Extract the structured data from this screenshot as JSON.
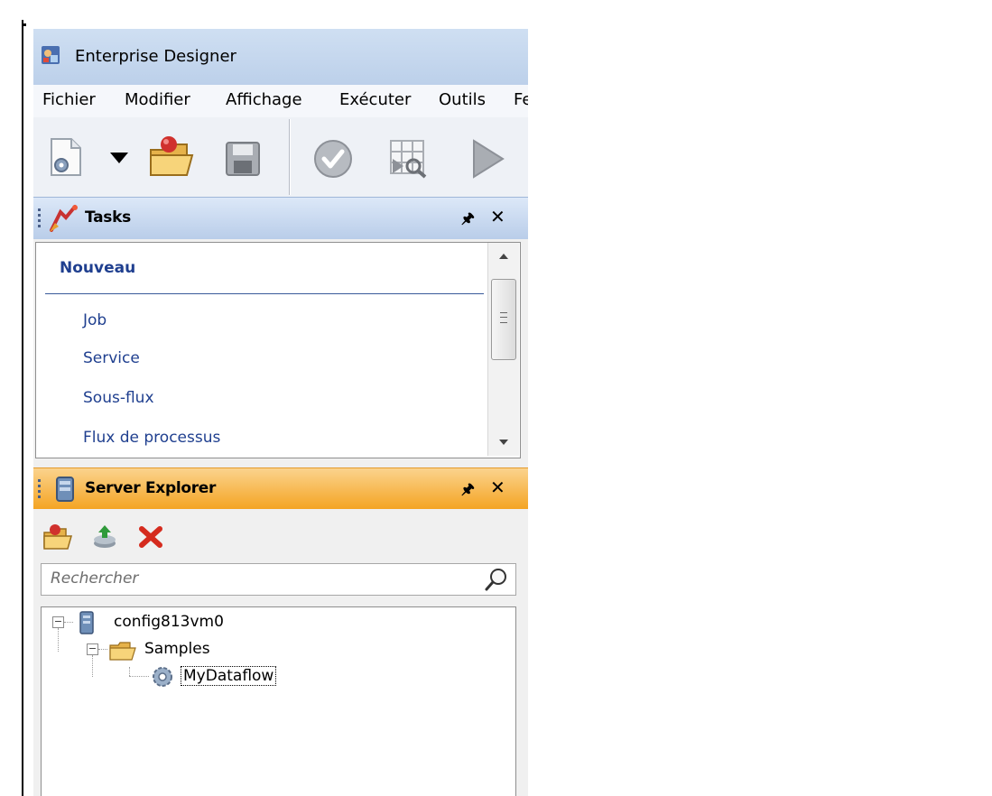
{
  "window": {
    "title": "Enterprise Designer"
  },
  "menu": {
    "items": [
      "Fichier",
      "Modifier",
      "Affichage",
      "Exécuter",
      "Outils",
      "Fe"
    ]
  },
  "toolbar": {
    "buttons": [
      "new-icon",
      "dropdown-arrow-icon",
      "open-folder-icon",
      "save-icon",
      "validate-icon",
      "inspect-icon",
      "run-icon"
    ]
  },
  "tasks": {
    "title": "Tasks",
    "section": "Nouveau",
    "links": [
      "Job",
      "Service",
      "Sous-flux",
      "Flux de processus"
    ]
  },
  "server_explorer": {
    "title": "Server Explorer",
    "search_placeholder": "Rechercher",
    "tree": {
      "server": "config813vm0",
      "folder": "Samples",
      "item": "MyDataflow"
    }
  },
  "colors": {
    "tasks_header": "#b9cde9",
    "server_header": "#f4a321",
    "link": "#1f3f8f"
  }
}
